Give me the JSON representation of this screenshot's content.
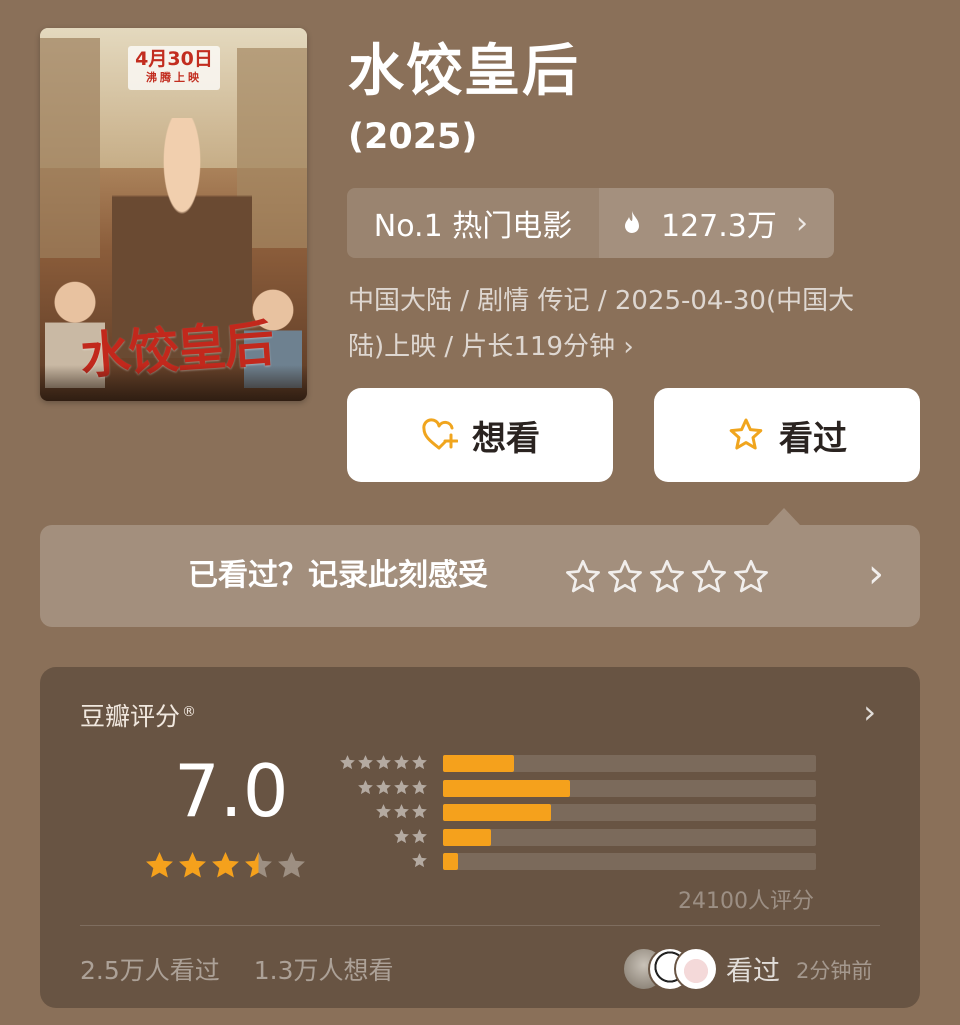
{
  "movie": {
    "title": "水饺皇后",
    "year": "(2025)",
    "poster": {
      "date": "4月30日",
      "release_tag": "沸腾上映",
      "title_art": "水饺皇后"
    }
  },
  "ranking": {
    "label": "No.1 热门电影",
    "heat": "127.3万",
    "heat_icon": "flame-icon"
  },
  "meta": {
    "line1": "中国大陆 / 剧情 传记 / 2025-04-30(中国大",
    "line2": "陆)上映 / 片长119分钟"
  },
  "actions": {
    "want_label": "想看",
    "seen_label": "看过"
  },
  "record": {
    "prompt": "已看过？记录此刻感受",
    "star_count": 5
  },
  "rating": {
    "label": "豆瓣评分",
    "mark": "®",
    "score": "7.0",
    "stars_value": 3.5,
    "stars_max": 5,
    "distribution": [
      {
        "stars": 5,
        "fraction": 0.19
      },
      {
        "stars": 4,
        "fraction": 0.34
      },
      {
        "stars": 3,
        "fraction": 0.29
      },
      {
        "stars": 2,
        "fraction": 0.13
      },
      {
        "stars": 1,
        "fraction": 0.04
      }
    ],
    "count": "24100人评分",
    "watched": "2.5万人看过",
    "wish": "1.3万人想看",
    "friend_action": "看过",
    "friend_time": "2分钟前"
  },
  "colors": {
    "background": "#8a7059",
    "card": "#685443",
    "accent": "#f5a11c"
  }
}
